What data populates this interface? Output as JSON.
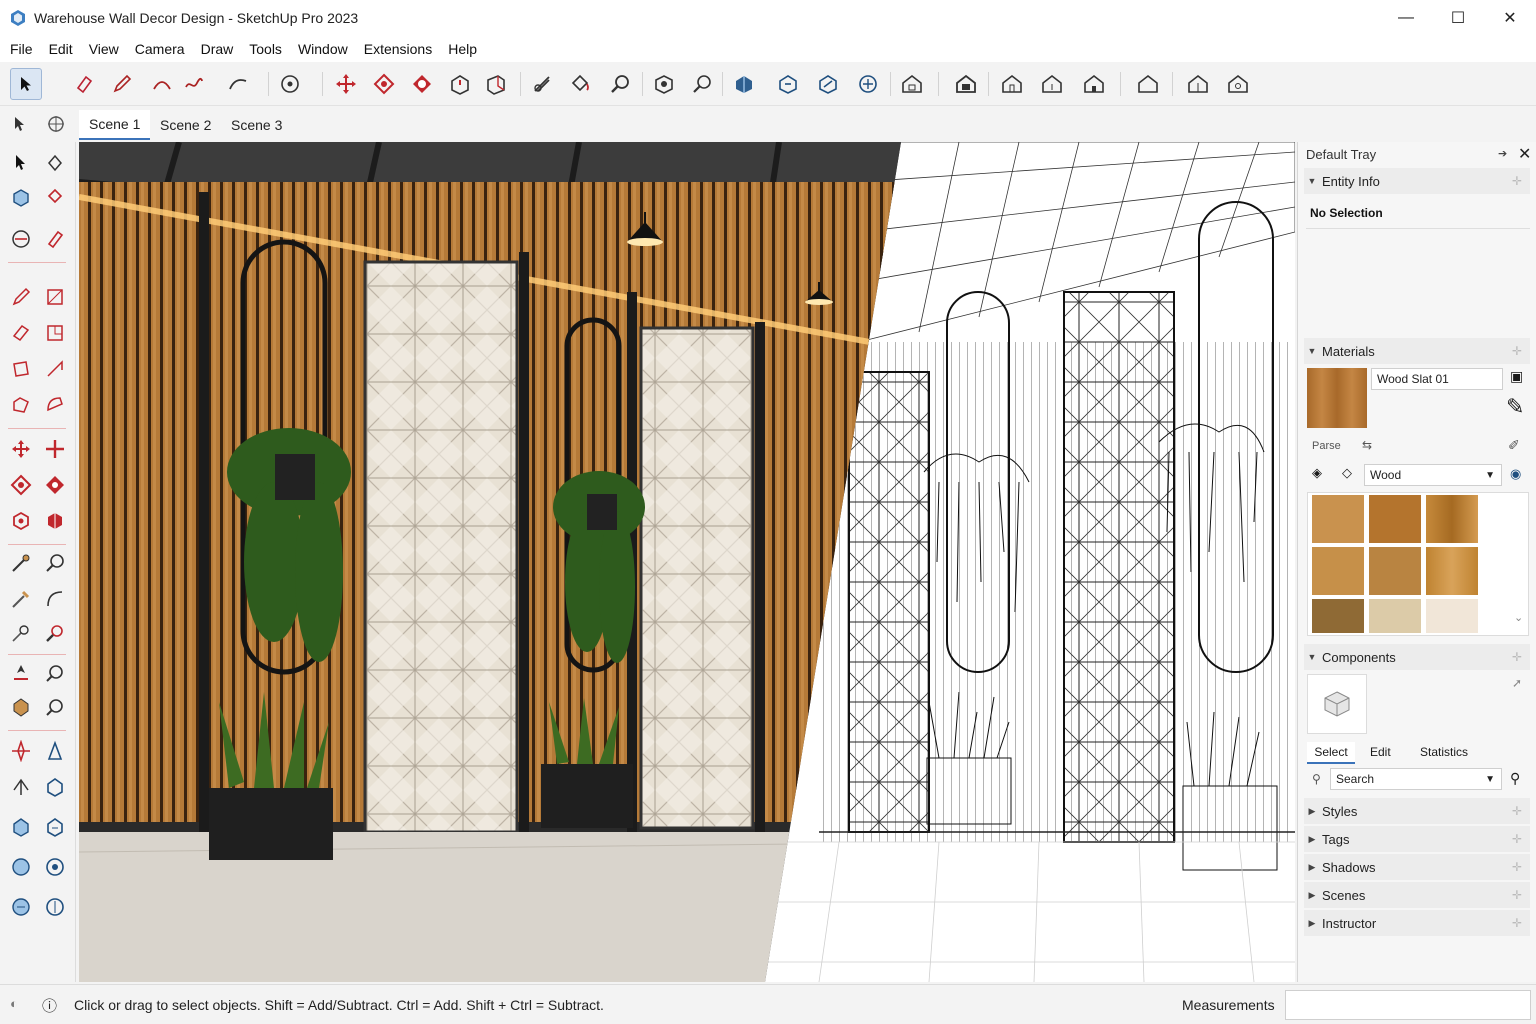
{
  "window": {
    "title": "Warehouse Wall Decor Design - SketchUp Pro 2023",
    "minimize_glyph": "—",
    "maximize_glyph": "☐",
    "close_glyph": "✕"
  },
  "menu": [
    "File",
    "Edit",
    "View",
    "Camera",
    "Draw",
    "Tools",
    "Window",
    "Extensions",
    "Help"
  ],
  "scenes": {
    "tabs": [
      "Scene 1",
      "Scene 2",
      "Scene 3"
    ],
    "active": "Scene 1"
  },
  "tray": {
    "title": "Default Tray",
    "entity_info": {
      "title": "Entity Info",
      "selection": "No Selection"
    },
    "materials": {
      "title": "Materials",
      "material_name": "Wood Slat 01",
      "library": "Wood",
      "small_label": "Parse",
      "swatch_colors": [
        "#c9924e",
        "#b4742d",
        "#c68a3b",
        "#c69049",
        "#b98441",
        "#bf8331",
        "#8f6a35",
        "#dccba8",
        "#f1e6d8"
      ]
    },
    "components": {
      "title": "Components",
      "tabs": [
        "Select",
        "Edit",
        "Statistics"
      ],
      "search_placeholder": "Search"
    },
    "collapsed_panels": [
      "Styles",
      "Tags",
      "Shadows",
      "Scenes",
      "Instructor"
    ]
  },
  "status": {
    "hint": "Click or drag to select objects. Shift = Add/Subtract. Ctrl = Add. Shift + Ctrl = Subtract.",
    "measurements_label": "Measurements",
    "measurements_value": ""
  },
  "colors": {
    "accent": "#3b73b9",
    "tool_red": "#c0272d",
    "wood": "#b57a38",
    "ceiling": "#3c3c3c"
  }
}
